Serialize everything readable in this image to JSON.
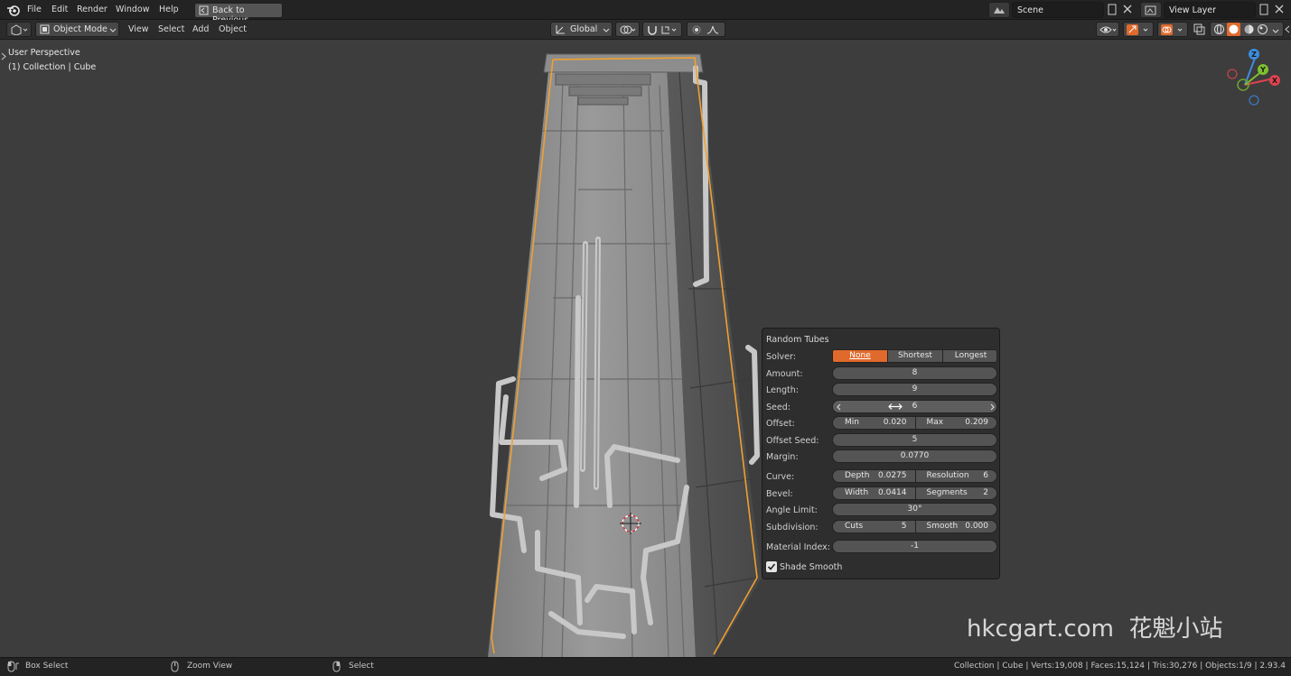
{
  "menu": {
    "items": [
      "File",
      "Edit",
      "Render",
      "Window",
      "Help"
    ],
    "back_button": "Back to Previous"
  },
  "scene": {
    "name": "Scene",
    "view_layer": "View Layer"
  },
  "toolbar": {
    "mode": "Object Mode",
    "menus": [
      "View",
      "Select",
      "Add",
      "Object"
    ],
    "transform_orientation": "Global"
  },
  "viewport": {
    "perspective_label": "User Perspective",
    "collection_label": "(1) Collection | Cube",
    "gizmo_axes": {
      "x": "X",
      "y": "Y",
      "z": "Z"
    }
  },
  "panel": {
    "title": "Random Tubes",
    "solver": {
      "label": "Solver:",
      "options": [
        "None",
        "Shortest",
        "Longest"
      ],
      "selected": "None"
    },
    "amount": {
      "label": "Amount:",
      "value": "8"
    },
    "length": {
      "label": "Length:",
      "value": "9"
    },
    "seed": {
      "label": "Seed:",
      "value": "6"
    },
    "offset": {
      "label": "Offset:",
      "min_label": "Min",
      "min_value": "0.020",
      "max_label": "Max",
      "max_value": "0.209"
    },
    "offset_seed": {
      "label": "Offset Seed:",
      "value": "5"
    },
    "margin": {
      "label": "Margin:",
      "value": "0.0770"
    },
    "curve": {
      "label": "Curve:",
      "depth_label": "Depth",
      "depth_value": "0.0275",
      "resolution_label": "Resolution",
      "resolution_value": "6"
    },
    "bevel": {
      "label": "Bevel:",
      "width_label": "Width",
      "width_value": "0.0414",
      "segments_label": "Segments",
      "segments_value": "2"
    },
    "angle_limit": {
      "label": "Angle Limit:",
      "value": "30°"
    },
    "subdivision": {
      "label": "Subdivision:",
      "cuts_label": "Cuts",
      "cuts_value": "5",
      "smooth_label": "Smooth",
      "smooth_value": "0.000"
    },
    "material_index": {
      "label": "Material Index:",
      "value": "-1"
    },
    "shade_smooth": {
      "label": "Shade Smooth",
      "checked": true
    }
  },
  "statusbar": {
    "box_select": "Box Select",
    "zoom_view": "Zoom View",
    "select": "Select",
    "stats": "Collection | Cube | Verts:19,008 | Faces:15,124 | Tris:30,276 | Objects:1/9 | 2.93.4"
  },
  "watermark": "hkcgart.com  花魁小站",
  "colors": {
    "accent_orange": "#e06a2c",
    "selection_outline": "#f0a030",
    "axis_x": "#e0434f",
    "axis_y": "#7fbf2f",
    "axis_z": "#3c8ee0"
  }
}
